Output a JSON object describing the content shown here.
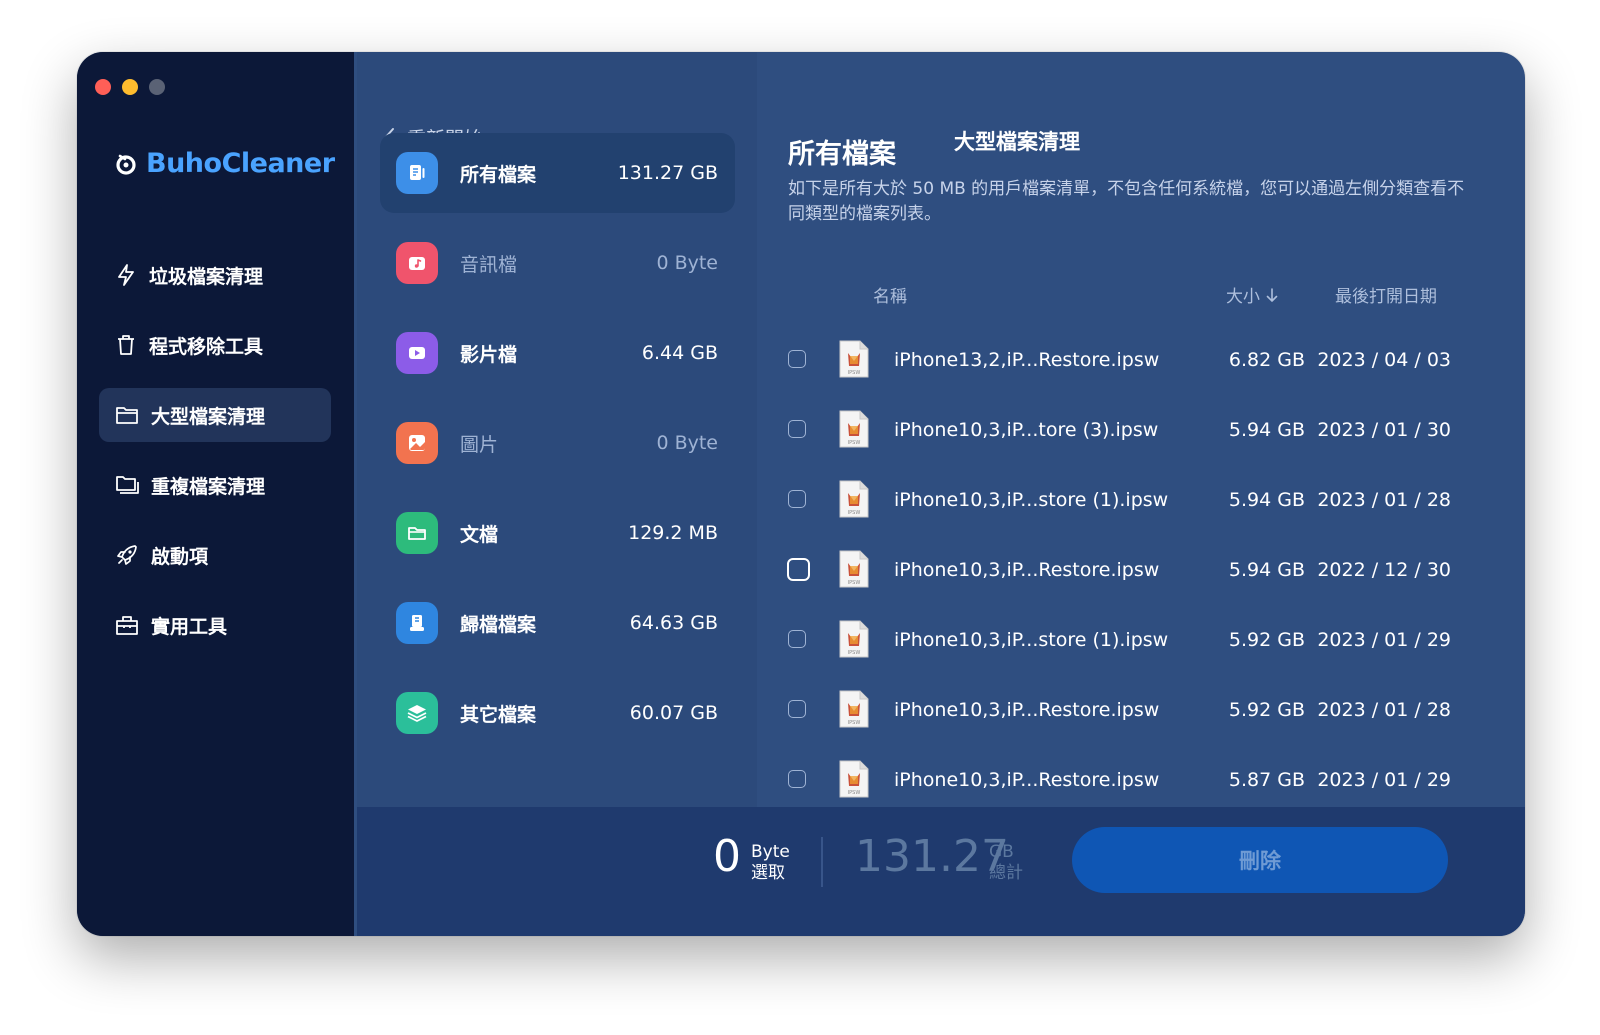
{
  "app": {
    "brand": "BuhoCleaner",
    "header_back": "重新開始",
    "header_title": "大型檔案清理"
  },
  "sidebar": {
    "items": [
      {
        "label": "垃圾檔案清理",
        "icon": "bolt-icon"
      },
      {
        "label": "程式移除工具",
        "icon": "trash-icon"
      },
      {
        "label": "大型檔案清理",
        "icon": "folder-icon",
        "active": true
      },
      {
        "label": "重複檔案清理",
        "icon": "duplicate-folder-icon"
      },
      {
        "label": "啟動項",
        "icon": "rocket-icon"
      },
      {
        "label": "實用工具",
        "icon": "toolbox-icon"
      }
    ]
  },
  "categories": [
    {
      "label": "所有檔案",
      "size": "131.27 GB",
      "icon": "all-files-icon",
      "color": "#3d8fe8",
      "active": true
    },
    {
      "label": "音訊檔",
      "size": "0 Byte",
      "icon": "music-icon",
      "color": "#f0546c",
      "dim": true
    },
    {
      "label": "影片檔",
      "size": "6.44 GB",
      "icon": "video-icon",
      "color": "#8c5ce8"
    },
    {
      "label": "圖片",
      "size": "0 Byte",
      "icon": "image-icon",
      "color": "#f2734f",
      "dim": true
    },
    {
      "label": "文檔",
      "size": "129.2 MB",
      "icon": "document-folder-icon",
      "color": "#2dbb7c"
    },
    {
      "label": "歸檔檔案",
      "size": "64.63 GB",
      "icon": "archive-icon",
      "color": "#2f86e0"
    },
    {
      "label": "其它檔案",
      "size": "60.07 GB",
      "icon": "layers-icon",
      "color": "#2bbf9a"
    }
  ],
  "main": {
    "title": "所有檔案",
    "description": "如下是所有大於 50 MB 的用戶檔案清單，不包含任何系統檔，您可以通過左側分類查看不同類型的檔案列表。",
    "columns": {
      "name": "名稱",
      "size": "大小",
      "date": "最後打開日期"
    },
    "files": [
      {
        "name": "iPhone13,2,iP...Restore.ipsw",
        "size": "6.82 GB",
        "date": "2023 / 04 / 03"
      },
      {
        "name": "iPhone10,3,iP...tore (3).ipsw",
        "size": "5.94 GB",
        "date": "2023 / 01 / 30"
      },
      {
        "name": "iPhone10,3,iP...store (1).ipsw",
        "size": "5.94 GB",
        "date": "2023 / 01 / 28"
      },
      {
        "name": "iPhone10,3,iP...Restore.ipsw",
        "size": "5.94 GB",
        "date": "2022 / 12 / 30",
        "focused": true
      },
      {
        "name": "iPhone10,3,iP...store (1).ipsw",
        "size": "5.92 GB",
        "date": "2023 / 01 / 29"
      },
      {
        "name": "iPhone10,3,iP...Restore.ipsw",
        "size": "5.92 GB",
        "date": "2023 / 01 / 28"
      },
      {
        "name": "iPhone10,3,iP...Restore.ipsw",
        "size": "5.87 GB",
        "date": "2023 / 01 / 29"
      }
    ],
    "file_icon_text": "IPSW"
  },
  "footer": {
    "selected_value": "0",
    "selected_unit": "Byte",
    "selected_label": "選取",
    "total_value": "131.27",
    "total_unit": "GB",
    "total_label": "總計",
    "delete_label": "刪除"
  }
}
